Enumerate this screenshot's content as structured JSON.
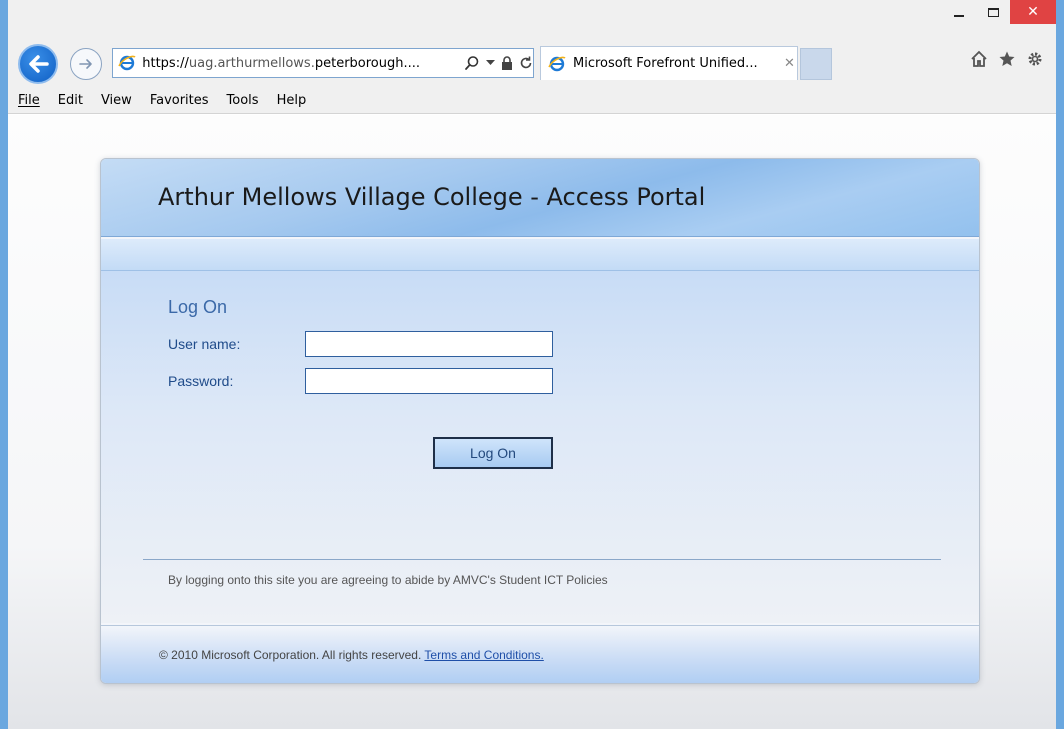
{
  "window": {
    "minimize_icon": "minimize-icon",
    "maximize_icon": "maximize-icon",
    "close_glyph": "✕"
  },
  "address_bar": {
    "url_protocol": "https://",
    "url_rest": "uag.arthurmellows.",
    "url_domain": "peterborough....",
    "search_icon": "search-icon",
    "dropdown_icon": "chevron-down-icon",
    "lock_icon": "lock-icon",
    "refresh_icon": "refresh-icon"
  },
  "tab": {
    "title": "Microsoft Forefront Unified...",
    "close_glyph": "✕"
  },
  "toolbar_icons": [
    "home-icon",
    "star-icon",
    "gear-icon"
  ],
  "menu": {
    "file": "File",
    "edit": "Edit",
    "view": "View",
    "favorites": "Favorites",
    "tools": "Tools",
    "help": "Help"
  },
  "portal": {
    "title": "Arthur Mellows Village College - Access Portal",
    "logon_heading": "Log On",
    "username_label": "User name:",
    "username_value": "",
    "password_label": "Password:",
    "password_value": "",
    "logon_button": "Log On",
    "policy_text": "By logging onto this site you are agreeing to abide by AMVC's Student ICT Policies",
    "footer_copyright": "© 2010 Microsoft Corporation. All rights reserved.",
    "footer_link": "Terms and Conditions."
  },
  "colors": {
    "accent": "#6aa7df",
    "close_button": "#e04343",
    "link": "#1f4fa8",
    "label": "#1f4b8a"
  }
}
